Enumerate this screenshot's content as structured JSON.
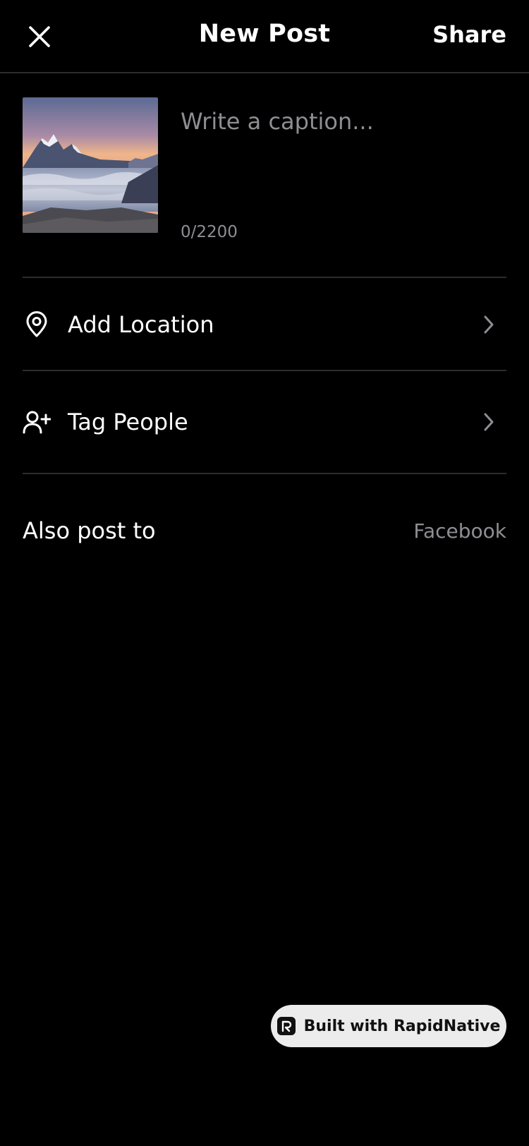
{
  "header": {
    "title": "New Post",
    "share_label": "Share",
    "close_icon": "close-icon"
  },
  "composer": {
    "thumbnail_alt": "mountain-sunset-photo",
    "caption_value": "",
    "caption_placeholder": "Write a caption...",
    "char_count": "0/2200"
  },
  "options": {
    "location": {
      "label": "Add Location",
      "icon": "location-pin-icon"
    },
    "tag_people": {
      "label": "Tag People",
      "icon": "user-plus-icon"
    }
  },
  "also_post": {
    "label": "Also post to",
    "value": "Facebook"
  },
  "badge": {
    "label": "Built with RapidNative"
  },
  "colors": {
    "background": "#000000",
    "text_primary": "#ffffff",
    "text_secondary": "#8e8e93",
    "divider": "#2c2c2e",
    "badge_bg": "#ececec"
  }
}
